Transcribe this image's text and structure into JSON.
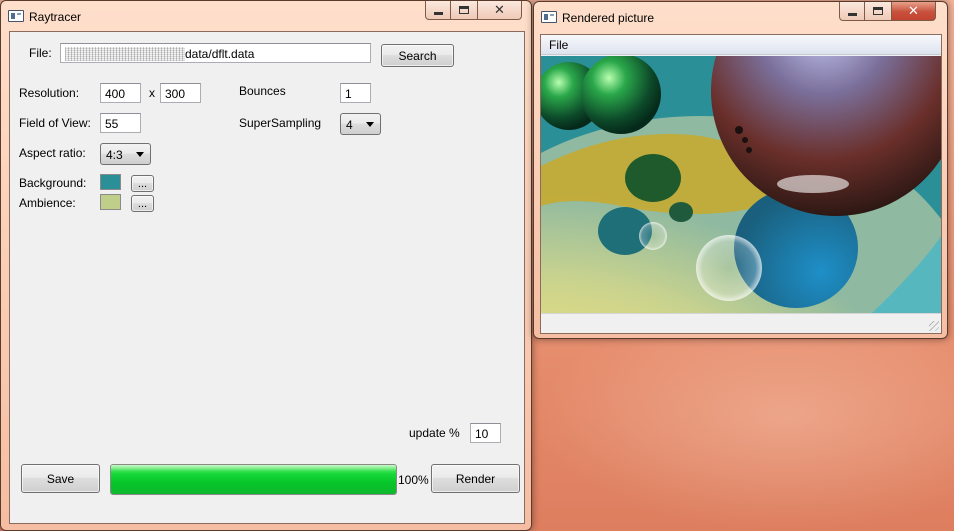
{
  "main_window": {
    "title": "Raytracer",
    "file": {
      "label": "File:",
      "path_visible": "data/dflt.data",
      "search_label": "Search"
    },
    "resolution": {
      "label": "Resolution:",
      "width": "400",
      "separator": "x",
      "height": "300"
    },
    "bounces": {
      "label": "Bounces",
      "value": "1"
    },
    "field_of_view": {
      "label": "Field of View:",
      "value": "55"
    },
    "supersampling": {
      "label": "SuperSampling",
      "value": "4"
    },
    "aspect_ratio": {
      "label": "Aspect ratio:",
      "value": "4:3"
    },
    "background": {
      "label": "Background:",
      "color": "#2b8f98",
      "button_label": "..."
    },
    "ambience": {
      "label": "Ambience:",
      "color": "#bfcf8a",
      "button_label": "..."
    },
    "update": {
      "label": "update %",
      "value": "10"
    },
    "save_label": "Save",
    "progress": {
      "value": 100,
      "text": "100%",
      "color": "#05c62a"
    },
    "render_label": "Render"
  },
  "render_window": {
    "title": "Rendered picture",
    "menu": [
      "File"
    ],
    "image_description_icon": "rendered-scene-image"
  }
}
